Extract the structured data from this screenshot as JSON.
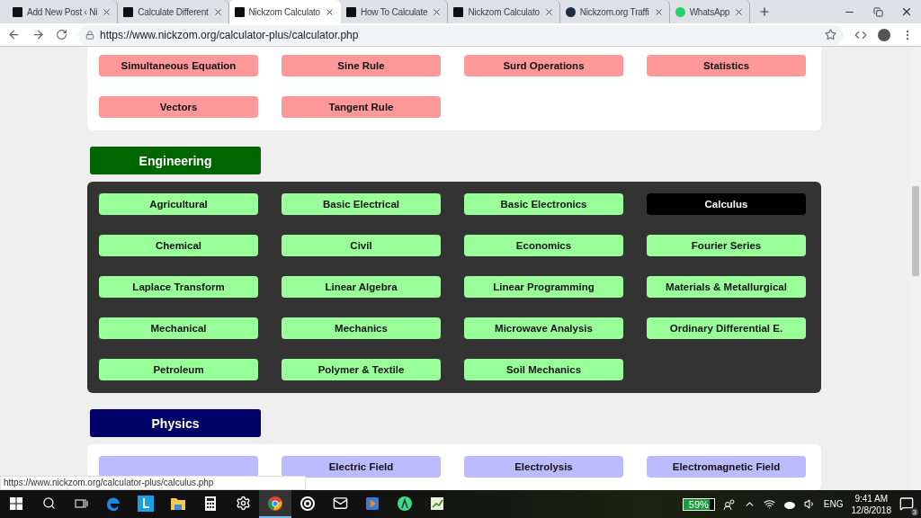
{
  "tabs": [
    {
      "title": "Add New Post ‹ Ni",
      "kind": "logo",
      "selected": false
    },
    {
      "title": "Calculate Different",
      "kind": "logo",
      "selected": false
    },
    {
      "title": "Nickzom Calculato",
      "kind": "logo",
      "selected": true
    },
    {
      "title": "How To Calculate",
      "kind": "logo",
      "selected": false
    },
    {
      "title": "Nickzom Calculato",
      "kind": "logo",
      "selected": false
    },
    {
      "title": "Nickzom.org Traffi",
      "kind": "circle",
      "selected": false
    },
    {
      "title": "WhatsApp",
      "kind": "chat",
      "selected": false
    }
  ],
  "address_bar": {
    "url": "https://www.nickzom.org/calculator-plus/calculator.php"
  },
  "sections": [
    {
      "kind": "top",
      "items": [
        {
          "label": "Simultaneous Equation",
          "selected": false
        },
        {
          "label": "Sine Rule",
          "selected": false
        },
        {
          "label": "Surd Operations",
          "selected": false
        },
        {
          "label": "Statistics",
          "selected": false
        },
        {
          "label": "Vectors",
          "selected": false
        },
        {
          "label": "Tangent Rule",
          "selected": false
        }
      ]
    },
    {
      "kind": "engineering",
      "heading": "Engineering",
      "items": [
        {
          "label": "Agricultural",
          "selected": false
        },
        {
          "label": "Basic Electrical",
          "selected": false
        },
        {
          "label": "Basic Electronics",
          "selected": false
        },
        {
          "label": "Calculus",
          "selected": true
        },
        {
          "label": "Chemical",
          "selected": false
        },
        {
          "label": "Civil",
          "selected": false
        },
        {
          "label": "Economics",
          "selected": false
        },
        {
          "label": "Fourier Series",
          "selected": false
        },
        {
          "label": "Laplace Transform",
          "selected": false
        },
        {
          "label": "Linear Algebra",
          "selected": false
        },
        {
          "label": "Linear Programming",
          "selected": false
        },
        {
          "label": "Materials & Metallurgical",
          "selected": false
        },
        {
          "label": "Mechanical",
          "selected": false
        },
        {
          "label": "Mechanics",
          "selected": false
        },
        {
          "label": "Microwave Analysis",
          "selected": false
        },
        {
          "label": "Ordinary Differential E.",
          "selected": false
        },
        {
          "label": "Petroleum",
          "selected": false
        },
        {
          "label": "Polymer & Textile",
          "selected": false
        },
        {
          "label": "Soil Mechanics",
          "selected": false
        }
      ]
    },
    {
      "kind": "physics",
      "heading": "Physics",
      "items": [
        {
          "selected": false
        },
        {
          "label": "Electric Field",
          "selected": false
        },
        {
          "label": "Electrolysis",
          "selected": false
        },
        {
          "label": "Electromagnetic Field",
          "selected": false
        }
      ]
    }
  ],
  "status_link": "https://www.nickzom.org/calculator-plus/calculus.php",
  "taskbar": {
    "apps": [
      {
        "kind": "edge",
        "active": false
      },
      {
        "kind": "letter",
        "active": false
      },
      {
        "kind": "folder",
        "active": false
      },
      {
        "kind": "calculator",
        "active": false
      },
      {
        "kind": "gear",
        "active": false
      },
      {
        "kind": "chrome",
        "active": true
      },
      {
        "kind": "ring",
        "active": false
      },
      {
        "kind": "mail",
        "active": false
      },
      {
        "kind": "media",
        "active": false
      },
      {
        "kind": "android",
        "active": false
      },
      {
        "kind": "chart",
        "active": false
      }
    ],
    "battery": {
      "reading": "59%",
      "level": 0.59
    },
    "language": "ENG",
    "time": "9:41 AM",
    "date": "12/8/2018",
    "notifications": "3"
  }
}
